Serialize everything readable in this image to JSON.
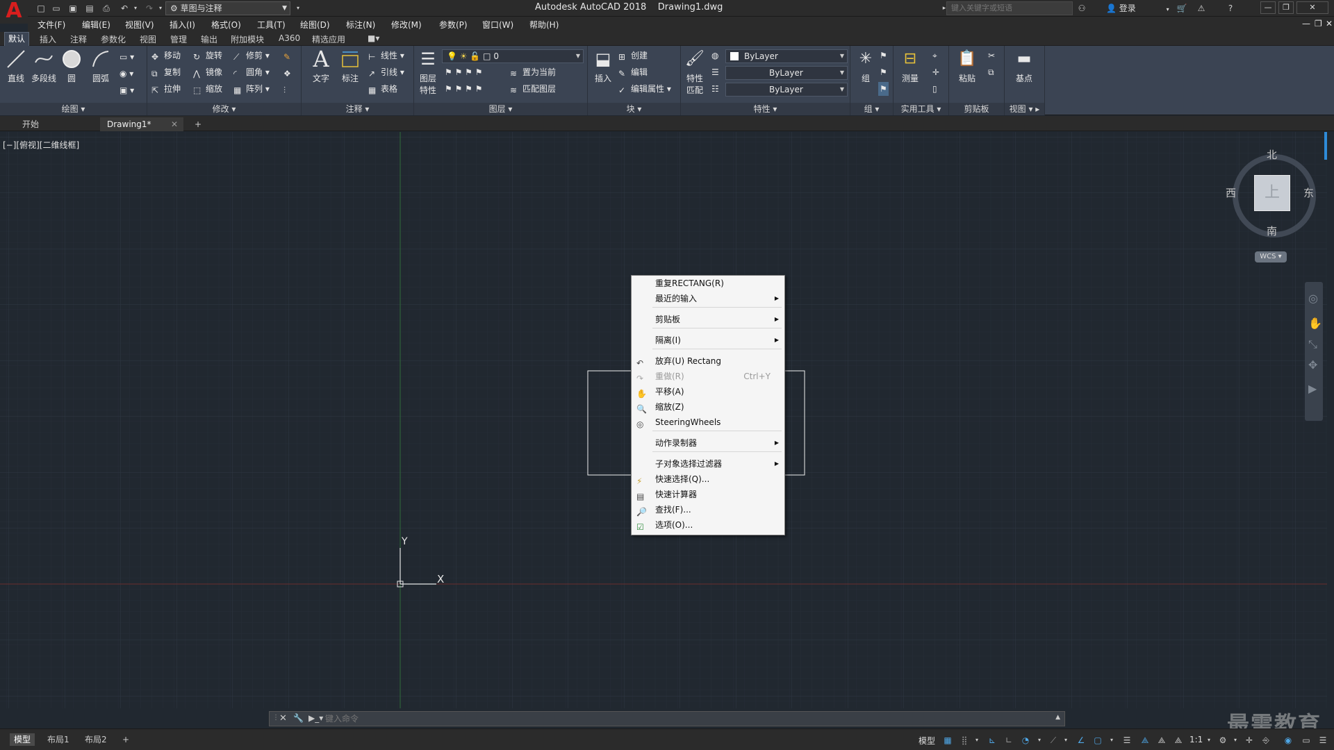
{
  "titlebar": {
    "app_title": "Autodesk AutoCAD 2018",
    "file_name": "Drawing1.dwg",
    "workspace": "草图与注释",
    "search_placeholder": "键入关键字或短语",
    "login": "登录"
  },
  "menubar": {
    "items": [
      "文件(F)",
      "编辑(E)",
      "视图(V)",
      "插入(I)",
      "格式(O)",
      "工具(T)",
      "绘图(D)",
      "标注(N)",
      "修改(M)",
      "参数(P)",
      "窗口(W)",
      "帮助(H)"
    ]
  },
  "ribbon_tabs": [
    "默认",
    "插入",
    "注释",
    "参数化",
    "视图",
    "管理",
    "输出",
    "附加模块",
    "A360",
    "精选应用"
  ],
  "ribbon": {
    "draw": {
      "title": "绘图",
      "line": "直线",
      "polyline": "多段线",
      "circle": "圆",
      "arc": "圆弧"
    },
    "modify": {
      "title": "修改",
      "move": "移动",
      "rotate": "旋转",
      "trim": "修剪",
      "copy": "复制",
      "mirror": "镜像",
      "fillet": "圆角",
      "stretch": "拉伸",
      "scale": "缩放",
      "array": "阵列"
    },
    "annotation": {
      "title": "注释",
      "text": "文字",
      "dimension": "标注",
      "linear": "线性",
      "leader": "引线",
      "table": "表格"
    },
    "layers": {
      "title": "图层",
      "layer_props_1": "图层",
      "layer_props_2": "特性",
      "current_layer": "0",
      "make_current": "置为当前",
      "match_layer": "匹配图层"
    },
    "block": {
      "title": "块",
      "insert": "插入",
      "create": "创建",
      "edit": "编辑",
      "edit_attrs": "编辑属性"
    },
    "properties": {
      "title": "特性",
      "match_1": "特性",
      "match_2": "匹配",
      "color": "ByLayer",
      "linetype": "ByLayer",
      "lineweight": "ByLayer"
    },
    "groups": {
      "title": "组",
      "group": "组"
    },
    "utilities": {
      "title": "实用工具",
      "measure": "测量"
    },
    "clipboard": {
      "title": "剪贴板",
      "paste": "粘贴"
    },
    "view": {
      "title": "视图",
      "base": "基点"
    }
  },
  "doc_tabs": {
    "start": "开始",
    "drawing": "Drawing1*",
    "add": "+"
  },
  "canvas": {
    "viewport_label": "[−][俯视][二维线框]",
    "ucs_x": "X",
    "ucs_y": "Y"
  },
  "viewcube": {
    "north": "北",
    "south": "南",
    "east": "东",
    "west": "西",
    "face": "上",
    "wcs": "WCS"
  },
  "context_menu": {
    "items": [
      {
        "label": "重复RECTANG(R)"
      },
      {
        "label": "最近的输入"
      },
      {
        "label": "剪贴板"
      },
      {
        "label": "隔离(I)"
      },
      {
        "label": "放弃(U) Rectang"
      },
      {
        "label": "重做(R)",
        "shortcut": "Ctrl+Y"
      },
      {
        "label": "平移(A)"
      },
      {
        "label": "缩放(Z)"
      },
      {
        "label": "SteeringWheels"
      },
      {
        "label": "动作录制器"
      },
      {
        "label": "子对象选择过滤器"
      },
      {
        "label": "快速选择(Q)..."
      },
      {
        "label": "快速计算器"
      },
      {
        "label": "查找(F)..."
      },
      {
        "label": "选项(O)..."
      }
    ]
  },
  "command_line": {
    "placeholder": "键入命令"
  },
  "statusbar": {
    "model_tab": "模型",
    "layout1": "布局1",
    "layout2": "布局2",
    "add": "+",
    "model_label": "模型",
    "scale": "1:1"
  },
  "watermark": "最需教育",
  "colors": {
    "canvas_bg": "#212830",
    "ribbon_bg": "#3b4453",
    "title_bg": "#2b2b2b",
    "menu_bg": "#f5f5f5",
    "accent_blue": "#4fa8e8",
    "y_axis": "#2e6b3a",
    "x_axis": "#6b2e2e"
  }
}
